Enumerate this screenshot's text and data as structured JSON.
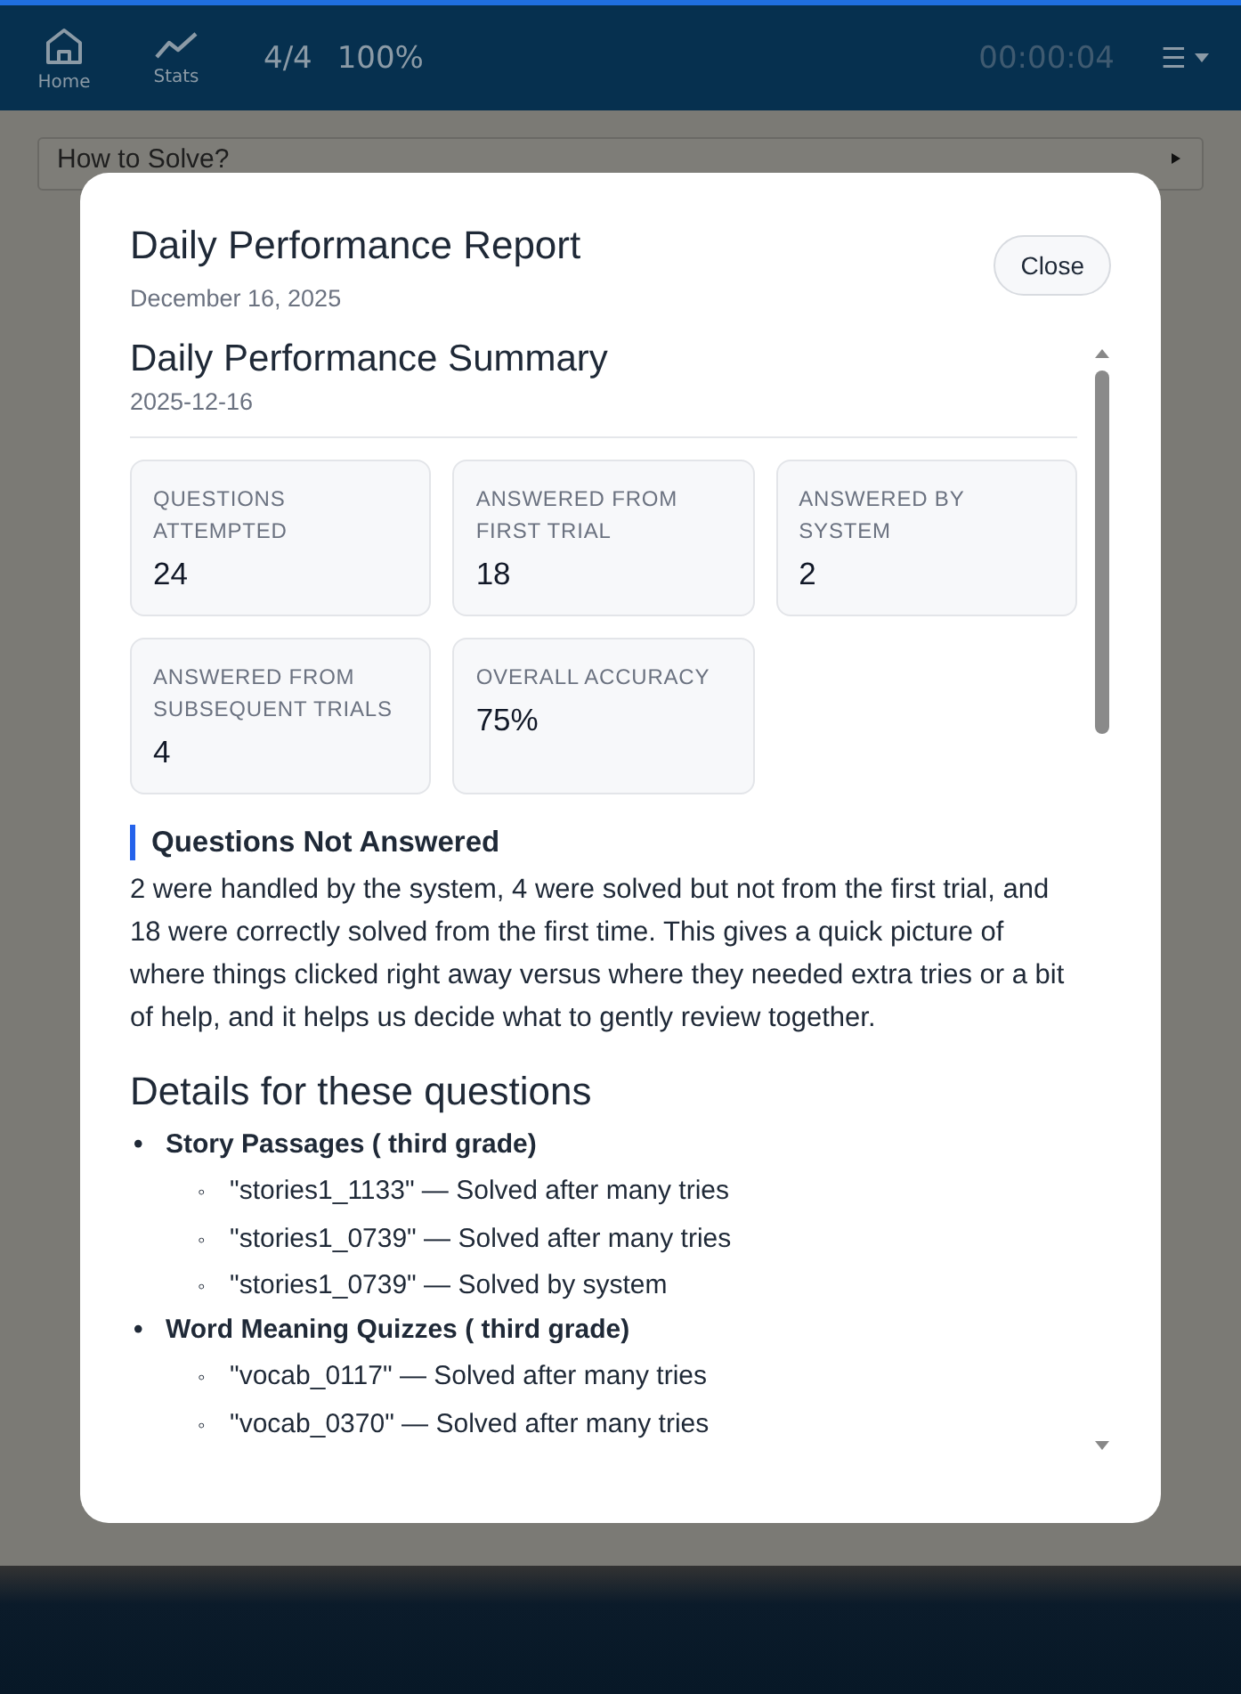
{
  "header": {
    "nav": [
      {
        "label": "Home",
        "kind": "home"
      },
      {
        "label": "Stats",
        "kind": "stats"
      }
    ],
    "progress": "4/4",
    "score": "100%",
    "timer": "00:00:04",
    "menu": "☰"
  },
  "help_bar": {
    "label": "How to Solve?",
    "expanded": false
  },
  "modal": {
    "title": "Daily Performance Report",
    "date": "December 16, 2025",
    "close": "Close",
    "summary": {
      "title": "Daily Performance Summary",
      "date": "2025-12-16",
      "stats": [
        {
          "label": "QUESTIONS ATTEMPTED",
          "value": "24"
        },
        {
          "label": "ANSWERED FROM FIRST TRIAL",
          "value": "18"
        },
        {
          "label": "ANSWERED BY SYSTEM",
          "value": "2"
        },
        {
          "label": "ANSWERED FROM SUBSEQUENT TRIALS",
          "value": "4"
        },
        {
          "label": "OVERALL ACCURACY",
          "value": "75%"
        }
      ],
      "section_title": "Questions Not Answered",
      "paragraph": "2 were handled by the system, 4 were solved but not from the first trial, and 18 were correctly solved from the first time. This gives a quick picture of where things clicked right away versus where they needed extra tries or a bit of help, and it helps us decide what to gently review together.",
      "details_title": "Details for these questions",
      "groups": [
        {
          "marker": "•",
          "name": "Story Passages ( third grade)",
          "items": [
            {
              "marker": "◦",
              "text": "\"stories1_1133\" — Solved after many tries"
            },
            {
              "marker": "◦",
              "text": "\"stories1_0739\" — Solved after many tries"
            },
            {
              "marker": "◦",
              "text": "\"stories1_0739\" — Solved by system"
            }
          ]
        },
        {
          "marker": "•",
          "name": "Word Meaning Quizzes ( third grade)",
          "items": [
            {
              "marker": "◦",
              "text": "\"vocab_0117\" — Solved after many tries"
            },
            {
              "marker": "◦",
              "text": "\"vocab_0370\" — Solved after many tries"
            }
          ]
        }
      ]
    }
  }
}
